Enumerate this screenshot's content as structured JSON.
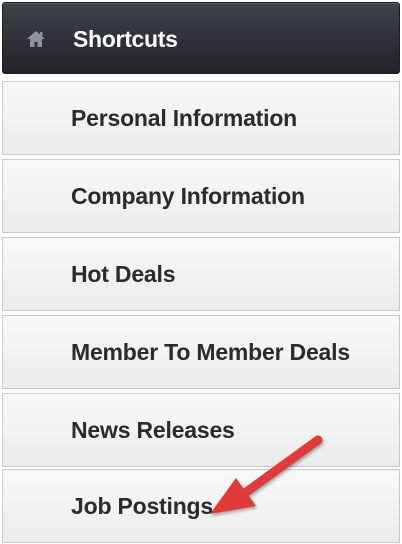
{
  "menu": {
    "header": {
      "title": "Shortcuts",
      "icon": "home-icon"
    },
    "items": [
      {
        "label": "Personal Information"
      },
      {
        "label": "Company Information"
      },
      {
        "label": "Hot Deals"
      },
      {
        "label": "Member To Member Deals"
      },
      {
        "label": "News Releases"
      },
      {
        "label": "Job Postings"
      }
    ]
  },
  "annotation": {
    "type": "arrow",
    "color": "#e03a3a",
    "points_to": "Job Postings"
  }
}
